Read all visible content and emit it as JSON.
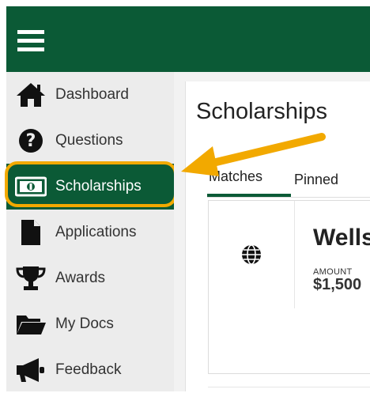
{
  "sidebar": {
    "items": [
      {
        "label": "Dashboard",
        "icon": "home-icon"
      },
      {
        "label": "Questions",
        "icon": "question-icon"
      },
      {
        "label": "Scholarships",
        "icon": "money-icon",
        "active": true
      },
      {
        "label": "Applications",
        "icon": "document-icon"
      },
      {
        "label": "Awards",
        "icon": "trophy-icon"
      },
      {
        "label": "My Docs",
        "icon": "folder-icon"
      },
      {
        "label": "Feedback",
        "icon": "megaphone-icon"
      }
    ]
  },
  "main": {
    "title": "Scholarships",
    "tabs": [
      {
        "label": "Matches",
        "active": true
      },
      {
        "label": "Pinned",
        "active": false
      }
    ],
    "card": {
      "title": "Wells",
      "amount_label": "AMOUNT",
      "amount_value": "$1,500",
      "icon": "globe-icon"
    }
  },
  "colors": {
    "brand_green": "#0b5a36",
    "highlight_orange": "#f2a900",
    "sidebar_bg": "#ececec"
  }
}
